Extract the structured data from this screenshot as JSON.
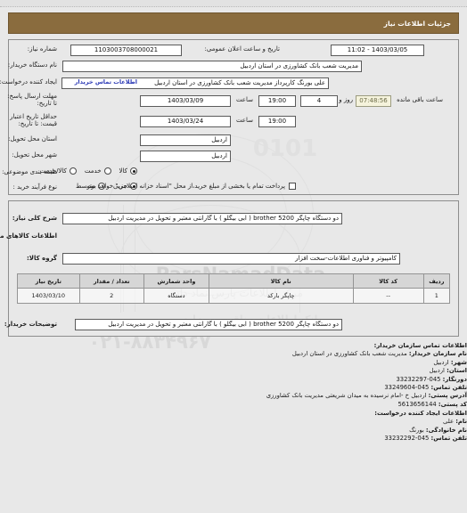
{
  "header": {
    "title": "جزئیات اطلاعات نیاز"
  },
  "form": {
    "need_number_label": "شماره نیاز:",
    "need_number_value": "1103003708000021",
    "announce_datetime_label": "تاریخ و ساعت اعلان عمومی:",
    "announce_datetime_value": "1403/03/05 - 11:02",
    "buyer_org_label": "نام دستگاه خریدار:",
    "buyer_org_value": "مدیریت شعب بانک کشاورزی در استان اردبیل",
    "requester_label": "ایجاد کننده درخواست:",
    "requester_value": "علی بورنگ کارپرداز مدیریت شعب بانک کشاورزی در استان اردبیل",
    "buyer_contact_link": "اطلاعات تماس خریدار",
    "deadline_label": "مهلت ارسال پاسخ: تا تاریخ:",
    "deadline_date": "1403/03/09",
    "deadline_hour_label": "ساعت",
    "deadline_hour": "19:00",
    "remaining_days": "4",
    "days_and_label": "روز و",
    "remaining_time": "07:48:56",
    "remaining_suffix": "ساعت باقی مانده",
    "validity_label": "حداقل تاریخ اعتبار قیمت: تا تاریخ:",
    "validity_date": "1403/03/24",
    "validity_hour_label": "ساعت",
    "validity_hour": "19:00",
    "province_label": "استان محل تحویل:",
    "province_value": "اردبیل",
    "city_label": "شهر محل تحویل:",
    "city_value": "اردبیل",
    "category_label": "طبقه بندی موضوعی:",
    "category_options": [
      "کالا",
      "خدمت",
      "کالا/خدمت"
    ],
    "category_selected_index": 0,
    "process_label": "نوع فرآیند خرید :",
    "process_options": [
      "جزیی",
      "متوسط"
    ],
    "process_selected_index": 0,
    "treasury_checkbox_label": "پرداخت تمام یا بخشی از مبلغ خرید،از محل \"اسناد خزانه اسلامی\" خواهد بود.",
    "treasury_checked": false
  },
  "description": {
    "need_summary_label": "شرح کلی نیاز:",
    "need_summary_value": "دو دستگاه چاپگر brother 5200 ( ابی بیگلو ) با گارانتی معتبر و تحویل در مدیریت اردبیل",
    "goods_info_heading": "اطلاعات کالاهای مورد نیاز",
    "goods_group_label": "گروه کالا:",
    "goods_group_value": "کامپیوتر و فناوری اطلاعات-سخت افزار"
  },
  "table": {
    "headers": [
      "ردیف",
      "کد کالا",
      "نام کالا",
      "واحد شمارش",
      "تعداد / مقدار",
      "تاریخ نیاز"
    ],
    "rows": [
      {
        "row_no": "1",
        "goods_code": "--",
        "goods_name": "چاپگر بارکد",
        "unit": "دستگاه",
        "quantity": "2",
        "need_date": "1403/03/10"
      }
    ]
  },
  "buyer_notes": {
    "label": "توضیحات خریدار:",
    "value": "دو دستگاه چاپگر brother 5200 ( ابی بیگلو ) با گارانتی معتبر و تحویل در مدیریت اردبیل"
  },
  "buyer_org_contact": {
    "heading": "اطلاعات تماس سازمان خریدار:",
    "org_name_label": "نام سازمان خریدار:",
    "org_name_value": "مدیریت شعب بانک کشاورزی در استان اردبیل",
    "city_label": "شهر:",
    "city_value": "اردبیل",
    "province_label": "استان:",
    "province_value": "اردبیل",
    "fax_label": "دورنگار:",
    "fax_value": "045-33232297",
    "phone_label": "تلفن تماس:",
    "phone_value": "045-33249604",
    "address_label": "آدرس پستی:",
    "address_value": "اردبیل خ -امام نرسیده به میدان شریعتی مدیریت بانک کشاورزی",
    "postal_code_label": "کد پستی:",
    "postal_code_value": "5613656144"
  },
  "requester_contact": {
    "heading": "اطلاعات ایجاد کننده درخواست:",
    "first_name_label": "نام:",
    "first_name_value": "علی",
    "last_name_label": "نام خانوادگی:",
    "last_name_value": "بورنگ",
    "phone_label": "تلفن تماس:",
    "phone_value": "045-33232292"
  },
  "watermarks": {
    "brand": "ParsNamadData",
    "brand_fa": "مرکز اطلاعات پارس نماد داده",
    "phone": "۰۲۱-۸۸۳۴۹۶۷",
    "bank_line": "بانک اطلاعات مناقصه ومزایده",
    "digits": "0101"
  }
}
